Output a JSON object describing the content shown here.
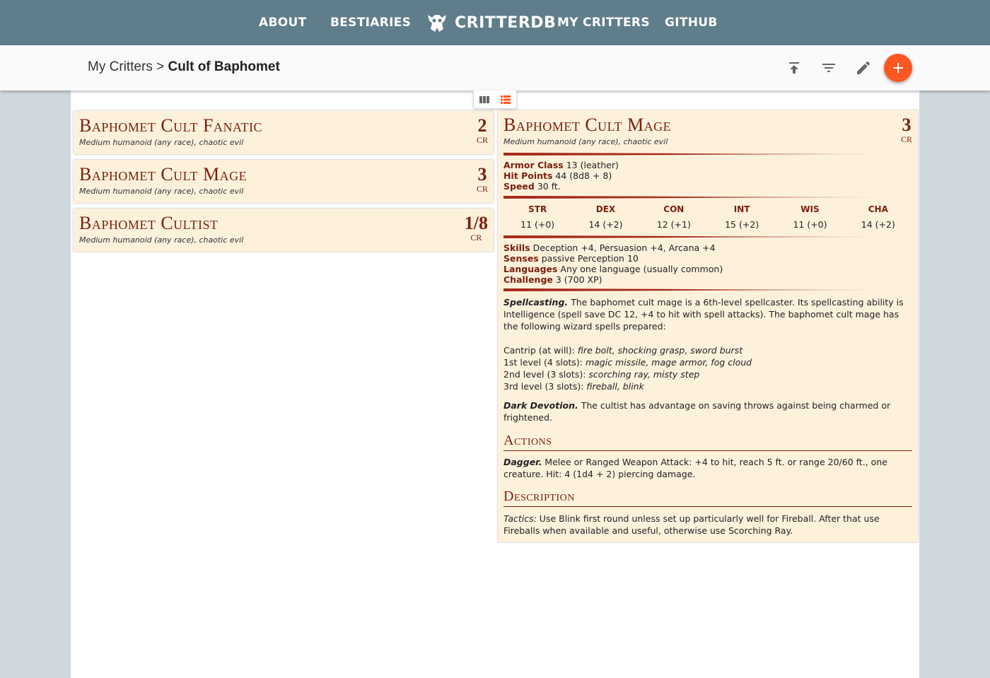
{
  "nav": {
    "about": "ABOUT",
    "bestiaries": "BESTIARIES",
    "logo_text": "CRITTERDB",
    "my_critters": "MY CRITTERS",
    "github": "GITHUB"
  },
  "toolbar": {
    "breadcrumb_root": "My Critters",
    "breadcrumb_sep": " > ",
    "breadcrumb_current": "Cult of Baphomet",
    "icons": [
      "upload-icon",
      "filter-icon",
      "edit-icon",
      "add-icon"
    ]
  },
  "view_toggle": {
    "icons": [
      "columns-icon",
      "list-icon"
    ],
    "active": "list"
  },
  "critters": [
    {
      "name": "Baphomet Cult Fanatic",
      "type": "Medium humanoid (any race), chaotic evil",
      "cr": "2",
      "cr_label": "CR"
    },
    {
      "name": "Baphomet Cult Mage",
      "type": "Medium humanoid (any race), chaotic evil",
      "cr": "3",
      "cr_label": "CR"
    },
    {
      "name": "Baphomet Cultist",
      "type": "Medium humanoid (any race), chaotic evil",
      "cr": "1/8",
      "cr_label": "CR"
    }
  ],
  "detail": {
    "name": "Baphomet Cult Mage",
    "type": "Medium humanoid (any race), chaotic evil",
    "cr": "3",
    "cr_label": "CR",
    "armor_class_label": "Armor Class",
    "armor_class": " 13 (leather)",
    "hit_points_label": "Hit Points",
    "hit_points": " 44 (8d8 + 8)",
    "speed_label": "Speed",
    "speed": " 30 ft.",
    "abilities": [
      {
        "name": "STR",
        "value": "11 (+0)"
      },
      {
        "name": "DEX",
        "value": "14 (+2)"
      },
      {
        "name": "CON",
        "value": "12 (+1)"
      },
      {
        "name": "INT",
        "value": "15 (+2)"
      },
      {
        "name": "WIS",
        "value": "11 (+0)"
      },
      {
        "name": "CHA",
        "value": "14 (+2)"
      }
    ],
    "skills_label": "Skills",
    "skills": " Deception +4, Persuasion +4, Arcana +4",
    "senses_label": "Senses",
    "senses": " passive Perception 10",
    "languages_label": "Languages",
    "languages": " Any one language (usually common)",
    "challenge_label": "Challenge",
    "challenge": " 3 (700 XP)",
    "spellcasting_title": "Spellcasting.",
    "spellcasting_text": " The baphomet cult mage is a 6th-level spellcaster. Its spellcasting ability is Intelligence (spell save DC 12, +4 to hit with spell attacks). The baphomet cult mage has the following wizard spells prepared:",
    "spells": [
      {
        "level": "Cantrip (at will): ",
        "list": "fire bolt, shocking grasp, sword burst"
      },
      {
        "level": "1st level (4 slots): ",
        "list": "magic missile, mage armor, fog cloud"
      },
      {
        "level": "2nd level (3 slots): ",
        "list": "scorching ray, misty step"
      },
      {
        "level": "3rd level (3 slots): ",
        "list": "fireball, blink"
      }
    ],
    "dark_devotion_title": "Dark Devotion.",
    "dark_devotion_text": " The cultist has advantage on saving throws against being charmed or frightened.",
    "actions_heading": "Actions",
    "dagger_title": "Dagger.",
    "dagger_text": " Melee or Ranged Weapon Attack: +4 to hit, reach 5 ft. or range 20/60 ft., one creature. Hit: 4 (1d4 + 2) piercing damage.",
    "description_heading": "Description",
    "tactics_label": "Tactics:",
    "tactics_text": " Use Blink first round unless set up particularly well for Fireball. After that use Fireballs when available and useful, otherwise use Scorching Ray."
  },
  "colors": {
    "nav_bg": "#607d8b",
    "accent": "#ff5722",
    "card_bg": "#fdf1dc",
    "critter_red": "#7a200d"
  }
}
